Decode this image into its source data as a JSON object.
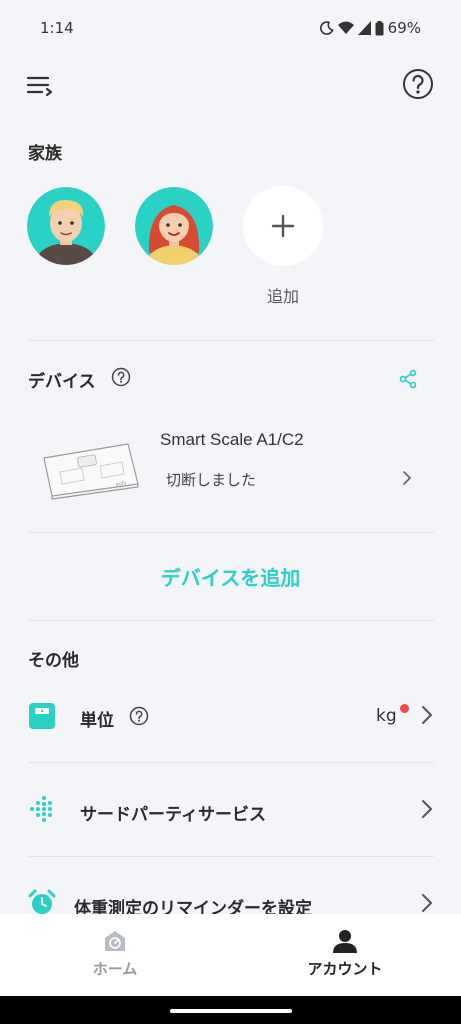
{
  "status_bar": {
    "time": "1:14",
    "battery": "69%",
    "icons": [
      "do-not-disturb-icon",
      "wifi-icon",
      "signal-icon",
      "battery-icon"
    ]
  },
  "header": {
    "menu_icon": "menu-icon",
    "help_icon": "help-icon"
  },
  "family": {
    "title": "家族",
    "members": [
      {
        "avatar": "male-avatar"
      },
      {
        "avatar": "female-avatar"
      }
    ],
    "add_label": "追加"
  },
  "devices": {
    "title": "デバイス",
    "items": [
      {
        "name": "Smart Scale A1/C2",
        "status": "切断しました"
      }
    ],
    "add_device_label": "デバイスを追加"
  },
  "other": {
    "title": "その他",
    "unit": {
      "label": "単位",
      "value": "kg"
    },
    "third_party": {
      "label": "サードパーティサービス"
    },
    "reminder": {
      "label": "体重測定のリマインダーを設定"
    }
  },
  "bottom_nav": {
    "home_label": "ホーム",
    "account_label": "アカウント"
  },
  "colors": {
    "accent": "#2ad1c7",
    "background": "#f4f5f9",
    "badge": "#f04a4a"
  }
}
